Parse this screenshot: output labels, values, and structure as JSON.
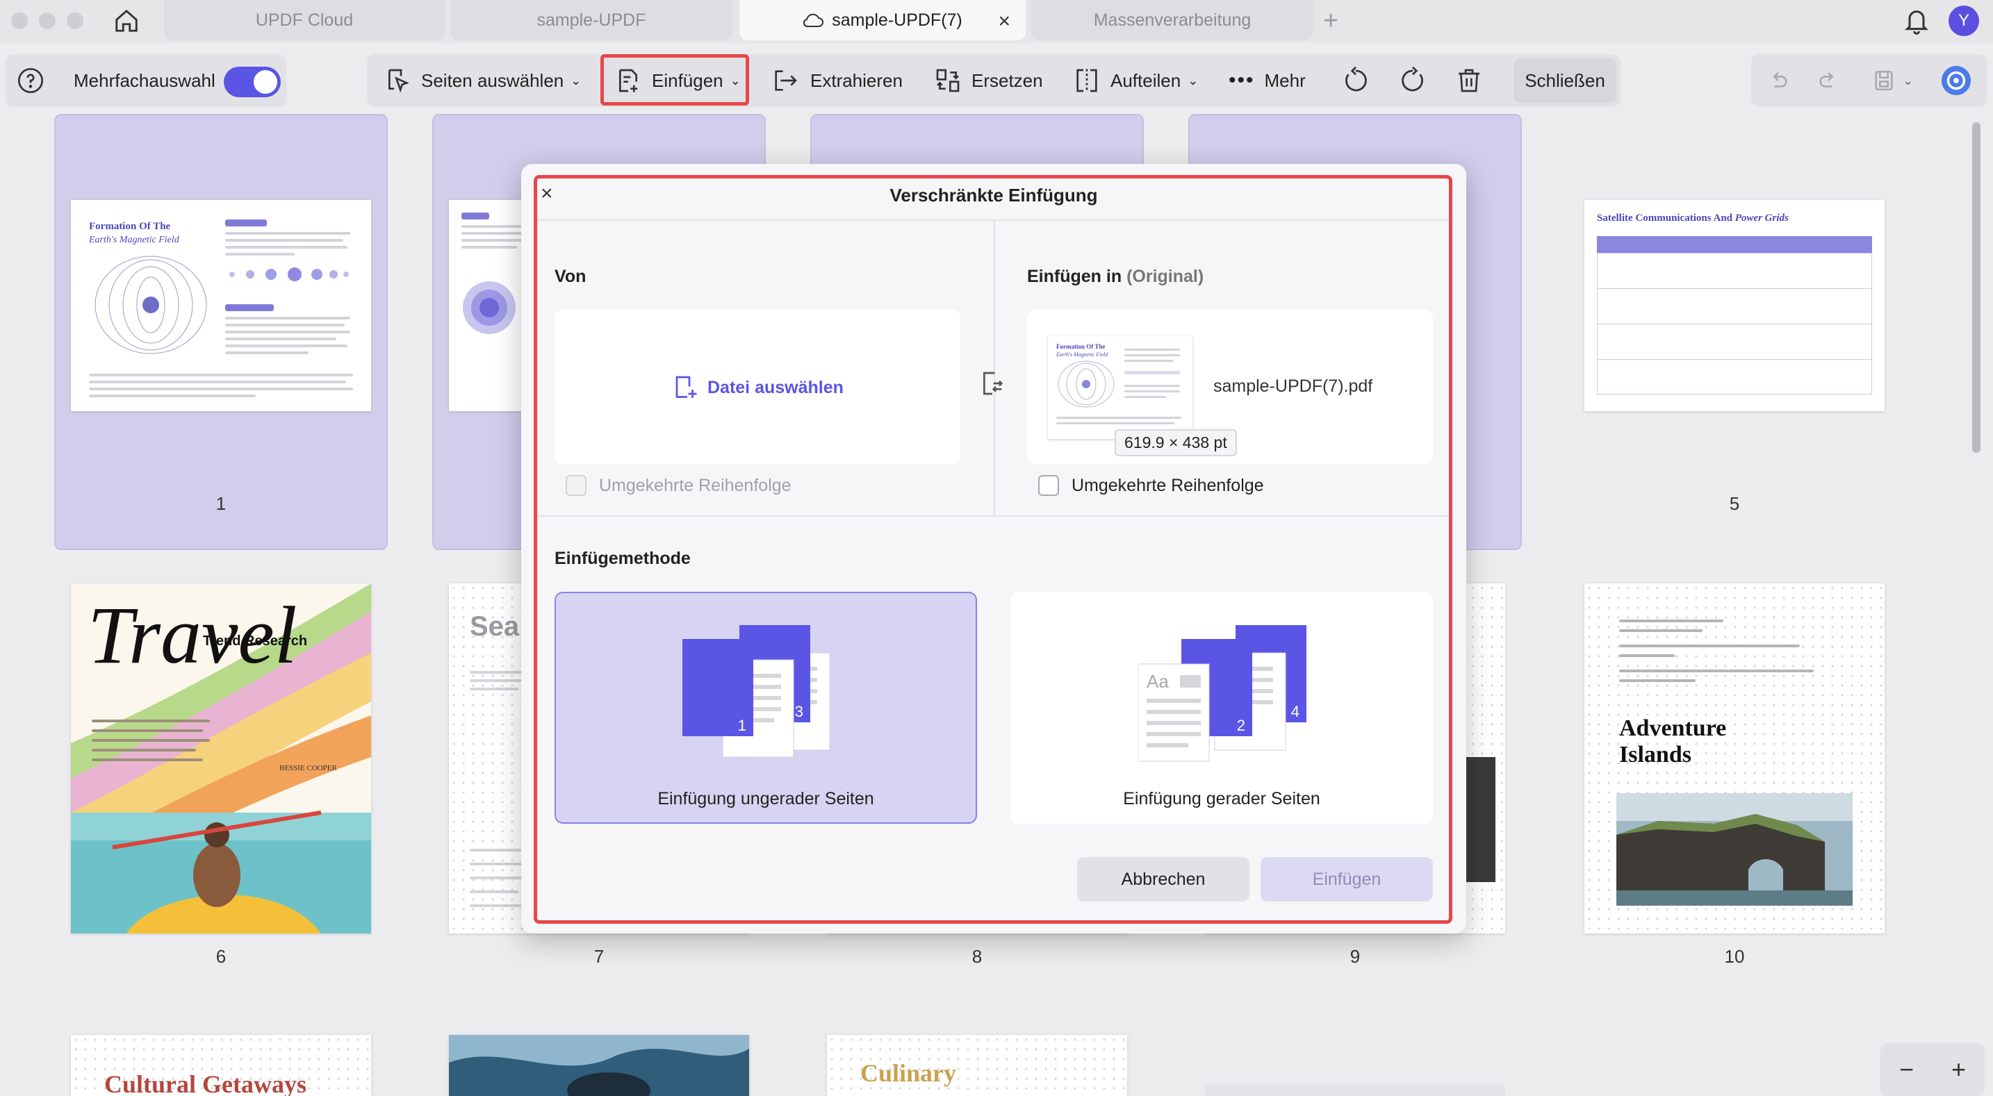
{
  "tabs": [
    {
      "label": "UPDF Cloud",
      "active": false
    },
    {
      "label": "sample-UPDF",
      "active": false
    },
    {
      "label": "sample-UPDF(7)",
      "active": true
    },
    {
      "label": "Massenverarbeitung",
      "active": false
    }
  ],
  "user": {
    "avatar_initial": "Y"
  },
  "toolbar": {
    "multi_select_label": "Mehrfachauswahl",
    "multi_select_on": true,
    "select_pages": "Seiten auswählen",
    "insert": "Einfügen",
    "extract": "Extrahieren",
    "replace": "Ersetzen",
    "split": "Aufteilen",
    "more": "Mehr",
    "close": "Schließen"
  },
  "pages": {
    "numbers": [
      "1",
      "5",
      "6",
      "7",
      "8",
      "9",
      "10"
    ],
    "p1": {
      "title": "Formation Of The",
      "subtitle": "Earth's Magnetic Field"
    },
    "p2": {
      "fragment": "Sea"
    },
    "p5": {
      "title_plain": "Satellite Communications And",
      "title_italic": "Power Grids"
    },
    "p6": {
      "title": "Travel",
      "badge": "Trend Research",
      "author": "BESSIE COOPER"
    },
    "p10": {
      "title_line1": "Adventure",
      "title_line2": "Islands"
    },
    "row3": {
      "p11_title": "Cultural Getaways",
      "p13_title": "Culinary"
    }
  },
  "modal": {
    "title": "Verschränkte Einfügung",
    "from_heading": "Von",
    "choose_file": "Datei auswählen",
    "from_reverse": "Umgekehrte Reihenfolge",
    "insert_into_heading": "Einfügen in",
    "insert_into_suffix": "(Original)",
    "target_filename": "sample-UPDF(7).pdf",
    "target_size_tooltip": "619.9 × 438 pt",
    "target_reverse": "Umgekehrte Reihenfolge",
    "method_heading": "Einfügemethode",
    "method_odd": "Einfügung ungerader Seiten",
    "method_even": "Einfügung gerader Seiten",
    "method_selected": "odd",
    "odd_page_digits": [
      "1",
      "3"
    ],
    "even_page_digits": [
      "2",
      "4"
    ],
    "even_page_text": "Aa",
    "cancel": "Abbrechen",
    "insert": "Einfügen"
  },
  "colors": {
    "accent": "#5a55e5",
    "highlight": "#e8474a",
    "selection": "#d1cdeb"
  }
}
